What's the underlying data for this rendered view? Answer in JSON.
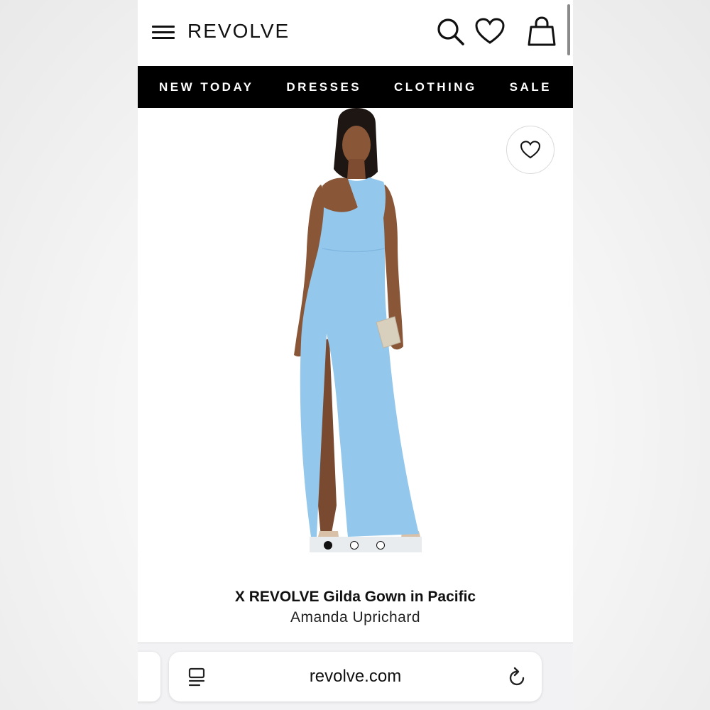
{
  "header": {
    "logo": "REVOLVE",
    "icons": [
      "menu-icon",
      "search-icon",
      "heart-icon",
      "bag-icon"
    ]
  },
  "nav": {
    "items": [
      {
        "label": "NEW TODAY"
      },
      {
        "label": "DRESSES"
      },
      {
        "label": "CLOTHING"
      },
      {
        "label": "SALE"
      }
    ]
  },
  "product": {
    "title": "X REVOLVE Gilda Gown in Pacific",
    "brand": "Amanda Uprichard",
    "dress_color": "#93c7ec",
    "image_count": 3,
    "active_image": 1
  },
  "browser": {
    "url": "revolve.com",
    "icons": [
      "tabs-icon",
      "reload-icon"
    ]
  },
  "colors": {
    "nav_bg": "#000000",
    "nav_text": "#ffffff",
    "text": "#111111"
  }
}
